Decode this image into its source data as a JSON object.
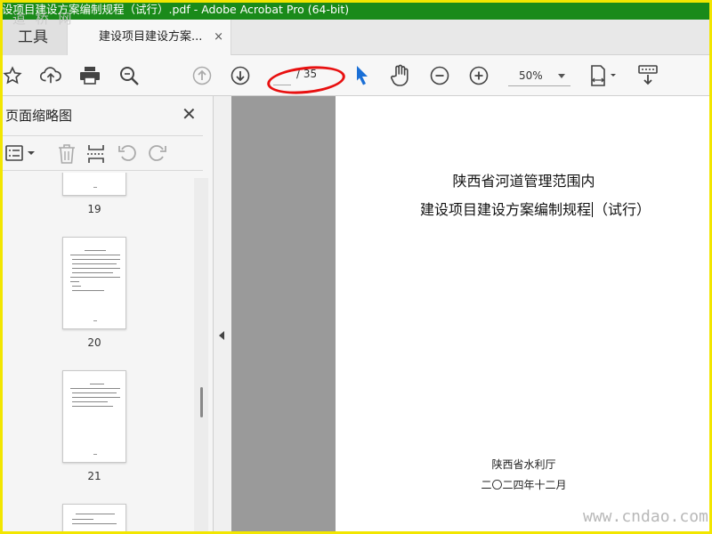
{
  "window": {
    "title": "设项目建设方案编制规程（试行）.pdf - Adobe Acrobat Pro (64-bit)"
  },
  "watermark": {
    "top": "道 桥 网",
    "bottom": "www.cndao.com"
  },
  "tabs": {
    "tools_label": "工具",
    "document_label": "建设项目建设方案...",
    "close_glyph": "×"
  },
  "toolbar": {
    "icons": [
      "bookmark-star-icon",
      "upload-cloud-icon",
      "print-icon",
      "search-zoom-icon",
      "page-up-icon",
      "page-down-icon",
      "select-cursor-icon",
      "hand-tool-icon",
      "zoom-out-icon",
      "zoom-in-icon",
      "fit-page-icon",
      "keyboard-tool-icon"
    ],
    "page_current": "",
    "page_total": "/ 35",
    "zoom_value": "50%"
  },
  "sidebar": {
    "title": "页面缩略图",
    "close_glyph": "✕",
    "thumbnails": [
      {
        "page": "19"
      },
      {
        "page": "20"
      },
      {
        "page": "21"
      }
    ]
  },
  "document": {
    "title_line1": "陕西省河道管理范围内",
    "title_line2a": "建设项目建设方案编制规程",
    "title_line2b": "（试行）",
    "footer_org": "陕西省水利厅",
    "footer_date": "二〇二四年十二月"
  },
  "colors": {
    "titlebar": "#1a8a1a",
    "frame": "#f2e600",
    "annotation_circle": "#e81010",
    "cursor_blue": "#1a6fd6"
  }
}
